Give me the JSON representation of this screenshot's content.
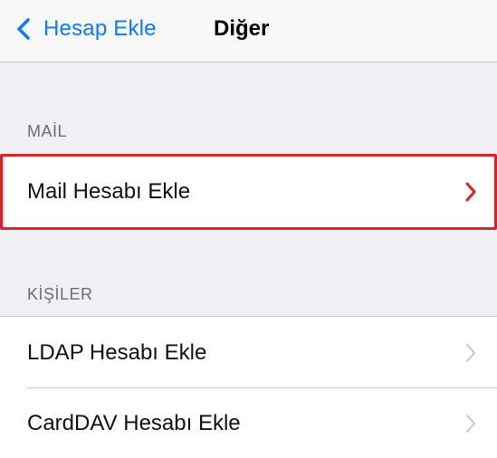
{
  "navbar": {
    "back_label": "Hesap Ekle",
    "title": "Diğer"
  },
  "sections": {
    "mail": {
      "header": "MAİL",
      "items": [
        {
          "label": "Mail Hesabı Ekle",
          "highlighted": true
        }
      ]
    },
    "kisiler": {
      "header": "KİŞİLER",
      "items": [
        {
          "label": "LDAP Hesabı Ekle"
        },
        {
          "label": "CardDAV Hesabı Ekle"
        }
      ]
    }
  },
  "colors": {
    "accent": "#0a7aff",
    "highlight_border": "#d8232a",
    "background": "#efeff4",
    "chevron_gray": "#c7c7cc"
  },
  "icons": {
    "back": "chevron-left-icon",
    "disclosure": "chevron-right-icon"
  }
}
